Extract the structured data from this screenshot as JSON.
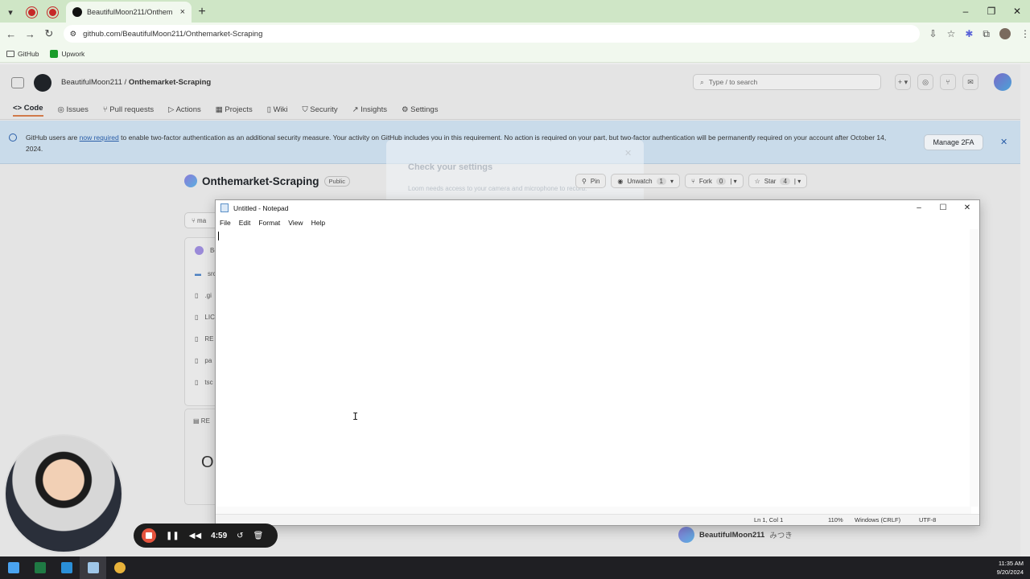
{
  "browser": {
    "tab_title": "BeautifulMoon211/Onthem",
    "tab_close": "×",
    "new_tab": "+",
    "url": "github.com/BeautifulMoon211/Onthemarket-Scraping",
    "bookmarks": [
      "GitHub",
      "Upwork"
    ],
    "win_min": "–",
    "win_restore": "❐",
    "win_close": "✕"
  },
  "github": {
    "owner": "BeautifulMoon211",
    "separator": "/",
    "repo": "Onthemarket-Scraping",
    "search_placeholder": "Type / to search",
    "nav": [
      "Code",
      "Issues",
      "Pull requests",
      "Actions",
      "Projects",
      "Wiki",
      "Security",
      "Insights",
      "Settings"
    ],
    "banner_text_before": "GitHub users are ",
    "banner_link": "now required",
    "banner_text_after": " to enable two-factor authentication as an additional security measure. Your activity on GitHub includes you in this requirement. No action is required on your part, but two-factor authentication will be permanently required on your account after October 14, 2024.",
    "manage_2fa": "Manage 2FA",
    "repo_visibility": "Public",
    "pin": "Pin",
    "unwatch": "Unwatch",
    "unwatch_count": "1",
    "fork": "Fork",
    "fork_count": "0",
    "star": "Star",
    "star_count": "4",
    "branch_label": "ma",
    "file_header": "Be",
    "files": [
      "src",
      ".gi",
      "LIC",
      "RE",
      "pa",
      "tsc"
    ],
    "readme_tab": "RE",
    "readme_heading": "O",
    "contributor": "BeautifulMoon211",
    "contributor_alt": "みつき"
  },
  "loom_modal": {
    "title": "Check your settings",
    "subtitle": "Loom needs access to your camera and microphone to record."
  },
  "notepad": {
    "title": "Untitled - Notepad",
    "menu": [
      "File",
      "Edit",
      "Format",
      "View",
      "Help"
    ],
    "status_position": "Ln 1, Col 1",
    "status_zoom": "110%",
    "status_eol": "Windows (CRLF)",
    "status_encoding": "UTF-8"
  },
  "loom": {
    "timer": "4:59"
  },
  "taskbar": {
    "time": "11:35 AM",
    "date": "9/20/2024"
  },
  "colors": {
    "browser_frame": "#cfe6c6",
    "banner_bg": "#c9dbea",
    "loom_stop": "#e5533d",
    "taskbar_bg": "#1f1f23"
  }
}
